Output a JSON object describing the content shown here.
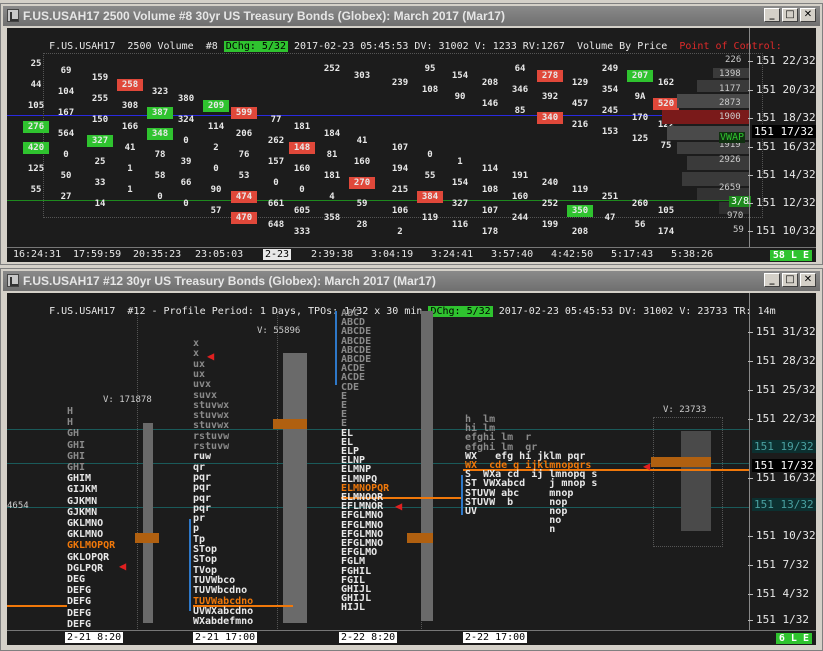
{
  "top": {
    "title": "F.US.USAH17  2500 Volume  #8  30yr US Treasury Bonds (Globex): March 2017 (Mar17)",
    "header": {
      "symbol": "F.US.USAH17",
      "bar_type": "2500 Volume",
      "chart_no": "#8",
      "dchg": "DChg: 5/32",
      "stamp": "2017-02-23 05:45:53 DV: 31002 V: 1233 RV:1267",
      "study": "Volume By Price",
      "poc": "Point of Control:"
    },
    "price_labels": [
      "151 22/32",
      "151 20/32",
      "151 18/32",
      "151 16/32",
      "151 14/32",
      "151 12/32",
      "151 10/32"
    ],
    "volume_labels": [
      "226",
      "1398",
      "1177",
      "2873",
      "1900",
      "4050",
      "1919",
      "2926",
      "2659",
      "970",
      "59"
    ],
    "vwap_label": "VWAP",
    "current_price": "151 17/32",
    "box_label": "3/8",
    "times": [
      "16:24:31",
      "17:59:59",
      "20:35:23",
      "23:05:03",
      "2-23",
      "2:39:38",
      "3:04:19",
      "3:24:41",
      "3:57:40",
      "4:42:50",
      "5:17:43",
      "5:38:26"
    ],
    "status": "58 L E",
    "cells": [
      {
        "t": "25",
        "k": "w"
      },
      {
        "t": "69",
        "k": "w"
      },
      {
        "t": "159",
        "k": "w"
      },
      {
        "t": "258",
        "k": "r"
      },
      {
        "t": "323",
        "k": "w"
      },
      {
        "t": "380",
        "k": "w"
      },
      {
        "t": "209",
        "k": "g"
      },
      {
        "t": "599",
        "k": "r"
      },
      {
        "t": "77",
        "k": "w"
      },
      {
        "t": "181",
        "k": "w"
      },
      {
        "t": "184",
        "k": "w"
      },
      {
        "t": "41",
        "k": "w"
      },
      {
        "t": "107",
        "k": "w"
      },
      {
        "t": "0",
        "k": "w"
      },
      {
        "t": "1",
        "k": "w"
      },
      {
        "t": "114",
        "k": "w"
      },
      {
        "t": "191",
        "k": "w"
      },
      {
        "t": "240",
        "k": "w"
      },
      {
        "t": "119",
        "k": "w"
      },
      {
        "t": "251",
        "k": "w"
      },
      {
        "t": "260",
        "k": "w"
      },
      {
        "t": "105",
        "k": "w"
      },
      {
        "t": "44",
        "k": "w"
      },
      {
        "t": "104",
        "k": "w"
      },
      {
        "t": "255",
        "k": "w"
      },
      {
        "t": "308",
        "k": "w"
      },
      {
        "t": "387",
        "k": "g"
      },
      {
        "t": "324",
        "k": "w"
      },
      {
        "t": "114",
        "k": "w"
      },
      {
        "t": "206",
        "k": "w"
      },
      {
        "t": "262",
        "k": "w"
      },
      {
        "t": "148",
        "k": "r"
      },
      {
        "t": "81",
        "k": "w"
      },
      {
        "t": "160",
        "k": "w"
      },
      {
        "t": "194",
        "k": "w"
      },
      {
        "t": "55",
        "k": "w"
      },
      {
        "t": "154",
        "k": "w"
      },
      {
        "t": "108",
        "k": "w"
      },
      {
        "t": "160",
        "k": "w"
      },
      {
        "t": "252",
        "k": "w"
      },
      {
        "t": "350",
        "k": "g"
      },
      {
        "t": "47",
        "k": "w"
      },
      {
        "t": "56",
        "k": "w"
      },
      {
        "t": "174",
        "k": "w"
      },
      {
        "t": "105",
        "k": "w"
      },
      {
        "t": "167",
        "k": "w"
      },
      {
        "t": "150",
        "k": "w"
      },
      {
        "t": "166",
        "k": "w"
      },
      {
        "t": "348",
        "k": "g"
      },
      {
        "t": "0",
        "k": "w"
      },
      {
        "t": "2",
        "k": "w"
      },
      {
        "t": "76",
        "k": "w"
      },
      {
        "t": "157",
        "k": "w"
      },
      {
        "t": "160",
        "k": "w"
      },
      {
        "t": "181",
        "k": "w"
      },
      {
        "t": "270",
        "k": "r"
      },
      {
        "t": "215",
        "k": "w"
      },
      {
        "t": "384",
        "k": "r"
      },
      {
        "t": "327",
        "k": "w"
      },
      {
        "t": "107",
        "k": "w"
      },
      {
        "t": "244",
        "k": "w"
      },
      {
        "t": "199",
        "k": "w"
      },
      {
        "t": "208",
        "k": "w"
      },
      {
        "t": "249",
        "k": "w"
      },
      {
        "t": "207",
        "k": "g"
      },
      {
        "t": "162",
        "k": "w"
      },
      {
        "t": "276",
        "k": "g"
      },
      {
        "t": "564",
        "k": "w"
      },
      {
        "t": "327",
        "k": "g"
      },
      {
        "t": "41",
        "k": "w"
      },
      {
        "t": "78",
        "k": "w"
      },
      {
        "t": "39",
        "k": "w"
      },
      {
        "t": "0",
        "k": "w"
      },
      {
        "t": "53",
        "k": "w"
      },
      {
        "t": "0",
        "k": "w"
      },
      {
        "t": "0",
        "k": "w"
      },
      {
        "t": "4",
        "k": "w"
      },
      {
        "t": "59",
        "k": "w"
      },
      {
        "t": "106",
        "k": "w"
      },
      {
        "t": "119",
        "k": "w"
      },
      {
        "t": "116",
        "k": "w"
      },
      {
        "t": "178",
        "k": "w"
      },
      {
        "t": "64",
        "k": "w"
      },
      {
        "t": "278",
        "k": "r"
      },
      {
        "t": "129",
        "k": "w"
      },
      {
        "t": "354",
        "k": "w"
      },
      {
        "t": "9A",
        "k": "w"
      },
      {
        "t": "520",
        "k": "r"
      },
      {
        "t": "420",
        "k": "g"
      },
      {
        "t": "0",
        "k": "w"
      },
      {
        "t": "25",
        "k": "w"
      },
      {
        "t": "1",
        "k": "w"
      },
      {
        "t": "58",
        "k": "w"
      },
      {
        "t": "66",
        "k": "w"
      },
      {
        "t": "90",
        "k": "w"
      },
      {
        "t": "474",
        "k": "r"
      },
      {
        "t": "661",
        "k": "w"
      },
      {
        "t": "605",
        "k": "w"
      },
      {
        "t": "358",
        "k": "w"
      },
      {
        "t": "28",
        "k": "w"
      },
      {
        "t": "2",
        "k": "w"
      },
      {
        "t": "95",
        "k": "w"
      },
      {
        "t": "154",
        "k": "w"
      },
      {
        "t": "208",
        "k": "w"
      },
      {
        "t": "346",
        "k": "w"
      },
      {
        "t": "392",
        "k": "w"
      },
      {
        "t": "457",
        "k": "w"
      },
      {
        "t": "245",
        "k": "w"
      },
      {
        "t": "170",
        "k": "w"
      },
      {
        "t": "122",
        "k": "w"
      },
      {
        "t": "125",
        "k": "w"
      },
      {
        "t": "50",
        "k": "w"
      },
      {
        "t": "33",
        "k": "w"
      },
      {
        "t": "1",
        "k": "w"
      },
      {
        "t": "0",
        "k": "w"
      },
      {
        "t": "0",
        "k": "w"
      },
      {
        "t": "57",
        "k": "w"
      },
      {
        "t": "470",
        "k": "r"
      },
      {
        "t": "648",
        "k": "w"
      },
      {
        "t": "333",
        "k": "w"
      },
      {
        "t": "252",
        "k": "w"
      },
      {
        "t": "303",
        "k": "w"
      },
      {
        "t": "239",
        "k": "w"
      },
      {
        "t": "108",
        "k": "w"
      },
      {
        "t": "90",
        "k": "w"
      },
      {
        "t": "146",
        "k": "w"
      },
      {
        "t": "85",
        "k": "w"
      },
      {
        "t": "340",
        "k": "r"
      },
      {
        "t": "216",
        "k": "w"
      },
      {
        "t": "153",
        "k": "w"
      },
      {
        "t": "125",
        "k": "w"
      },
      {
        "t": "75",
        "k": "w"
      },
      {
        "t": "55",
        "k": "w"
      },
      {
        "t": "27",
        "k": "w"
      },
      {
        "t": "14",
        "k": "w"
      }
    ]
  },
  "bottom": {
    "title": "F.US.USAH17  #12  30yr US Treasury Bonds (Globex): March 2017 (Mar17)",
    "header": {
      "symbol": "F.US.USAH17",
      "chart_no": "#12",
      "profile": "Profile Period: 1 Days, TPOs: 1/32 x 30 min",
      "dchg": "DChg: 5/32",
      "stamp": "2017-02-23 05:45:53 DV: 31002 V: 23733 TR: 14m"
    },
    "price_labels": [
      "151 31/32",
      "151 28/32",
      "151 25/32",
      "151 22/32",
      "151 19/32",
      "151 16/32",
      "151 13/32",
      "151 10/32",
      "151 7/32",
      "151 4/32",
      "151 1/32"
    ],
    "marked_prices": [
      "151 19/32",
      "151 17/32",
      "151 13/32"
    ],
    "volume_labels": [
      "V: 171878",
      "V: 55896",
      "V: 23733",
      "4654"
    ],
    "times": [
      "2-21  8:20",
      "2-21  17:00",
      "2-22  8:20",
      "2-22  17:00"
    ],
    "status": "6 L E",
    "profile1": [
      "H",
      "H",
      "GH",
      "GHI",
      "GHI",
      "GHI",
      "GHIM",
      "GIJKM",
      "GJKMN",
      "GJKMN",
      "GKLMNO",
      "GKLMNO",
      "GKLMOPQR",
      "GKLOPQR",
      "DGLPQR",
      "DEG",
      "DEFG",
      "DEFG",
      "DEFG",
      "DEFG"
    ],
    "profile2": [
      "x",
      "x",
      "ux",
      "ux",
      "uvx",
      "suvx",
      "stuvwx",
      "stuvwx",
      "stuvwx",
      "rstuvw",
      "rstuvw",
      "ruw",
      "qr",
      "pqr",
      "pqr",
      "pqr",
      "pqr",
      "pr",
      "p",
      "Tp",
      "STop",
      "STop",
      "TVop",
      "TUVWbco",
      "TUVWbcdno",
      "TUVWabcdno",
      "UVWXabcdno",
      "WXabdefmno"
    ],
    "profile3": [
      "ABC",
      "ABCD",
      "ABCDE",
      "ABCDE",
      "ABCDE",
      "ABCDE",
      "ACDE",
      "ACDE",
      "CDE",
      "E",
      "E",
      "E",
      "E",
      "EL",
      "EL",
      "ELP",
      "ELNP",
      "ELMNP",
      "ELMNPQ",
      "ELMNOPQR",
      "ELMNOQR",
      "EFLMNOR",
      "EFGLMNO",
      "EFGLMNO",
      "EFGLMNO",
      "EFGLMNO",
      "EFGLMO",
      "FGLM",
      "FGHIL",
      "FGIL",
      "GHIJL",
      "GHIJL",
      "HIJL"
    ],
    "profile4": [
      "h  lm",
      "hi lm",
      "efghi lm  r",
      "efghi lm  qr",
      "WX   efg hi jklm pqr",
      "WX  cde g ijklmnopqrs",
      "S  WXa cd  ij lmnopq s",
      "ST VWXabcd    j mnop s",
      "STUVW abc     mnop",
      "STUVW  b      nop",
      "UV            nop",
      "              no",
      "              n"
    ]
  },
  "colors": {
    "bg": "#1c1c1c",
    "red": "#e0483a",
    "green": "#2fc32f",
    "orange": "#f0780a",
    "blue": "#2e78c8",
    "teal": "#1a5a5a"
  }
}
